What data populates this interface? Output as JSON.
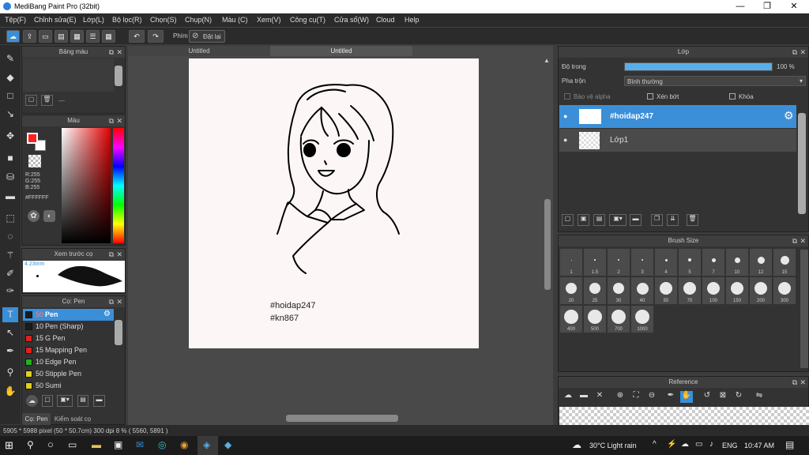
{
  "app": {
    "title": "MediBang Paint Pro (32bit)"
  },
  "window_controls": {
    "minimize": "—",
    "maximize": "❐",
    "close": "✕"
  },
  "menu": [
    "Tệp(F)",
    "Chỉnh sửa(E)",
    "Lớp(L)",
    "Bộ lọc(R)",
    "Chọn(S)",
    "Chụp(N)",
    "Màu (C)",
    "Xem(V)",
    "Công cụ(T)",
    "Cửa sổ(W)",
    "Cloud",
    "Help"
  ],
  "toolbar": {
    "key_label": "Phím",
    "reset_label": "Đặt lại"
  },
  "tabs": [
    "Untitled",
    "Untitled"
  ],
  "panels": {
    "palette": {
      "title": "Bảng màu",
      "list_placeholder": "---"
    },
    "color": {
      "title": "Màu",
      "r": "R:255",
      "g": "G:255",
      "b": "B:255",
      "hex": "#FFFFFF",
      "foreground": "#ff2020",
      "background": "#ffffff"
    },
    "preview": {
      "title": "Xem trước cọ",
      "size": "4.23mm"
    },
    "brush": {
      "title": "Cọ: Pen",
      "items": [
        {
          "size": "50",
          "name": "Pen",
          "color": "#1c1c1c",
          "selected": true
        },
        {
          "size": "10",
          "name": "Pen (Sharp)",
          "color": "#1c1c1c"
        },
        {
          "size": "15",
          "name": "G Pen",
          "color": "#e02020"
        },
        {
          "size": "15",
          "name": "Mapping Pen",
          "color": "#e02020"
        },
        {
          "size": "10",
          "name": "Edge Pen",
          "color": "#20b020"
        },
        {
          "size": "50",
          "name": "Stipple Pen",
          "color": "#e0d020"
        },
        {
          "size": "50",
          "name": "Sumi",
          "color": "#e0d020"
        }
      ],
      "footer_tabs": [
        "Cọ: Pen",
        "Kiểm soát cọ"
      ]
    },
    "layer": {
      "title": "Lớp",
      "opacity_label": "Độ trong",
      "opacity_value": 100,
      "opacity_text": "100 %",
      "blend_label": "Pha trộn",
      "blend_value": "Bình thường",
      "protect_alpha": "Bảo vệ alpha",
      "clipping": "Xén bớt",
      "lock": "Khóa",
      "layers": [
        {
          "name": "#hoidap247",
          "selected": true
        },
        {
          "name": "Lớp1",
          "selected": false
        }
      ]
    },
    "brush_size": {
      "title": "Brush Size",
      "sizes": [
        "1",
        "1.5",
        "2",
        "3",
        "4",
        "5",
        "7",
        "10",
        "12",
        "15",
        "20",
        "25",
        "30",
        "40",
        "50",
        "70",
        "100",
        "150",
        "200",
        "300",
        "400",
        "500",
        "700",
        "1000"
      ]
    },
    "reference": {
      "title": "Reference"
    }
  },
  "canvas_text": {
    "line1": "#hoidap247",
    "line2": "#kn867"
  },
  "status": {
    "text": "5905 * 5988 pixel  (50 * 50.7cm)  300 dpi  8 %  ( 5560, 5891 )"
  },
  "taskbar": {
    "weather": "30°C  Light rain",
    "lang": "ENG",
    "time": "10:47 AM"
  }
}
